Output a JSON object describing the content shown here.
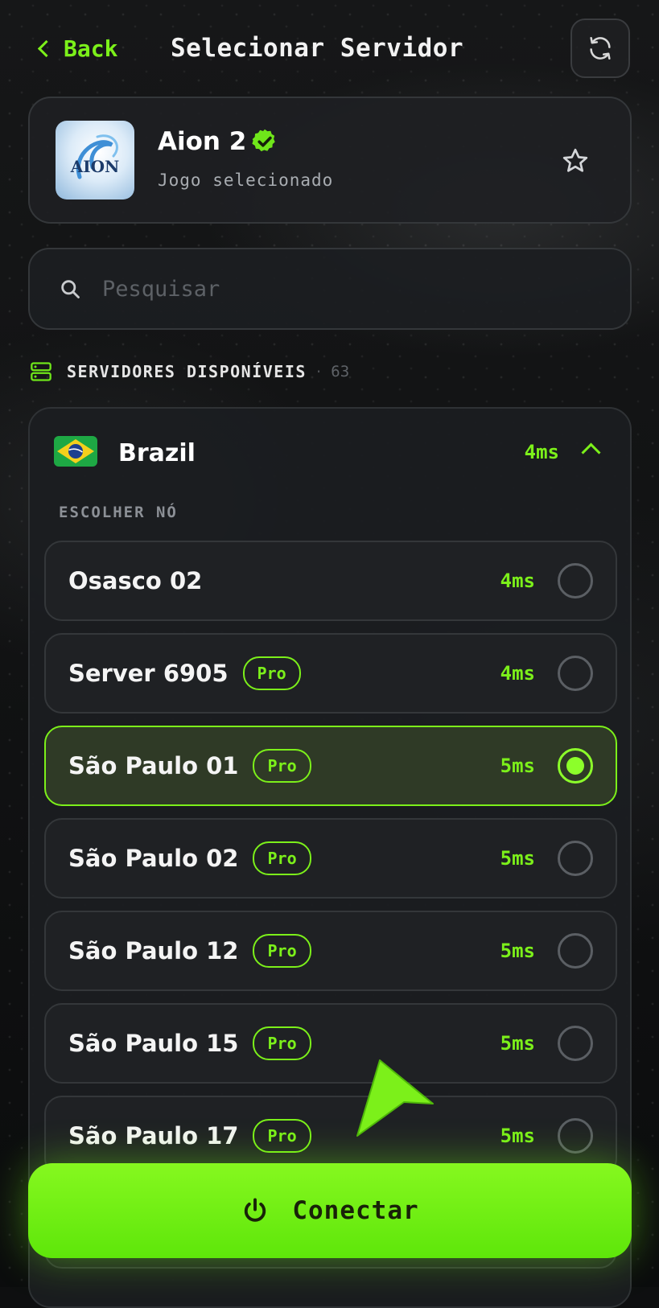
{
  "header": {
    "back_label": "Back",
    "title": "Selecionar Servidor",
    "refresh_icon": "refresh-icon"
  },
  "game": {
    "name": "Aion 2",
    "subtitle": "Jogo selecionado",
    "logo_text": "AION",
    "verified": true
  },
  "search": {
    "placeholder": "Pesquisar",
    "value": ""
  },
  "servers_section": {
    "title": "SERVIDORES DISPONÍVEIS",
    "count": "63"
  },
  "region": {
    "name": "Brazil",
    "ping": "4ms",
    "expanded": true,
    "choose_label": "ESCOLHER NÓ",
    "nodes": [
      {
        "name": "Osasco 02",
        "pro": false,
        "ping": "4ms",
        "selected": false
      },
      {
        "name": "Server 6905",
        "pro": true,
        "ping": "4ms",
        "selected": false
      },
      {
        "name": "São Paulo 01",
        "pro": true,
        "ping": "5ms",
        "selected": true
      },
      {
        "name": "São Paulo 02",
        "pro": true,
        "ping": "5ms",
        "selected": false
      },
      {
        "name": "São Paulo 12",
        "pro": true,
        "ping": "5ms",
        "selected": false
      },
      {
        "name": "São Paulo 15",
        "pro": true,
        "ping": "5ms",
        "selected": false
      },
      {
        "name": "São Paulo 17",
        "pro": true,
        "ping": "5ms",
        "selected": false
      }
    ],
    "pro_label": "Pro"
  },
  "connect_button": {
    "label": "Conectar"
  },
  "colors": {
    "accent": "#7cf01a",
    "background": "#0e0f10",
    "card": "#1f2124",
    "selected_bg": "#2f3a26"
  }
}
